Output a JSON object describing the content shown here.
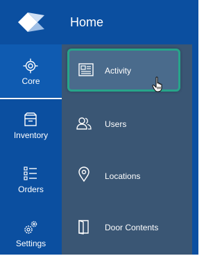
{
  "header": {
    "title": "Home",
    "logo_icon": "diamond-logo-icon"
  },
  "rail": {
    "items": [
      {
        "label": "Core",
        "icon": "target-icon",
        "active": true
      },
      {
        "label": "Inventory",
        "icon": "inventory-box-icon",
        "active": false
      },
      {
        "label": "Orders",
        "icon": "list-icon",
        "active": false
      },
      {
        "label": "Settings",
        "icon": "gears-icon",
        "active": false
      }
    ]
  },
  "submenu": {
    "items": [
      {
        "label": "Activity",
        "icon": "newspaper-icon",
        "highlighted": true
      },
      {
        "label": "Users",
        "icon": "users-icon",
        "highlighted": false
      },
      {
        "label": "Locations",
        "icon": "location-pin-icon",
        "highlighted": false
      },
      {
        "label": "Door Contents",
        "icon": "door-icon",
        "highlighted": false
      }
    ]
  },
  "colors": {
    "brand_blue": "#0b4fa0",
    "submenu_bg": "#3a5674",
    "highlight_border": "#27a58a",
    "text": "#ffffff"
  },
  "cursor": {
    "icon": "hand-pointer-icon"
  }
}
